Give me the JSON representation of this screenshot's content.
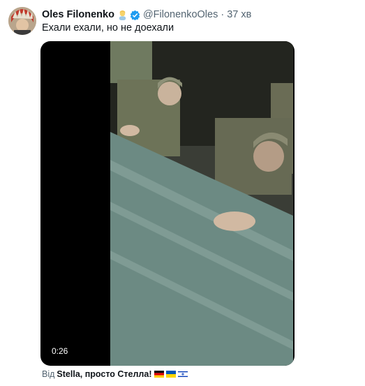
{
  "tweet": {
    "display_name": "Oles Filonenko",
    "badge_emoji_icon": "person-emoji-icon",
    "verified_icon": "verified-badge-icon",
    "handle": "@FilonenkoOles",
    "separator": "·",
    "time": "37 хв",
    "text": "Ехали ехали, но не доехали"
  },
  "media": {
    "duration": "0:26"
  },
  "source": {
    "prefix": "Від",
    "name": "Stella, просто Стелла!",
    "flags": [
      "germany-flag-icon",
      "ukraine-flag-icon",
      "israel-flag-icon"
    ]
  },
  "colors": {
    "text": "#0f1419",
    "secondary_text": "#536471",
    "verified": "#1d9bf0"
  }
}
